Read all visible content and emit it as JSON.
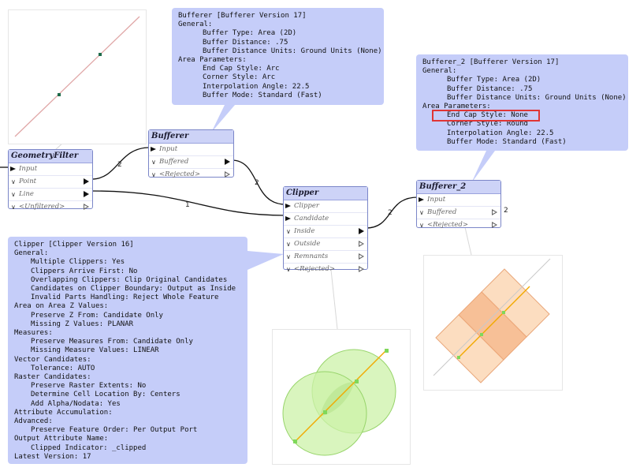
{
  "annotations": {
    "bufferer": {
      "lines": [
        {
          "text": "Bufferer [Bufferer Version 17]",
          "indent": 0
        },
        {
          "text": "General:",
          "indent": 0
        },
        {
          "text": "Buffer Type: Area (2D)",
          "indent": 2
        },
        {
          "text": "Buffer Distance: .75",
          "indent": 2
        },
        {
          "text": "Buffer Distance Units: Ground Units (None)",
          "indent": 2
        },
        {
          "text": "Area Parameters:",
          "indent": 0
        },
        {
          "text": "End Cap Style: Arc",
          "indent": 2
        },
        {
          "text": "Corner Style: Arc",
          "indent": 2
        },
        {
          "text": "Interpolation Angle: 22.5",
          "indent": 2
        },
        {
          "text": "Buffer Mode: Standard (Fast)",
          "indent": 2
        }
      ]
    },
    "bufferer_2": {
      "lines": [
        {
          "text": "Bufferer_2 [Bufferer Version 17]",
          "indent": 0
        },
        {
          "text": "General:",
          "indent": 0
        },
        {
          "text": "Buffer Type: Area (2D)",
          "indent": 2
        },
        {
          "text": "Buffer Distance: .75",
          "indent": 2
        },
        {
          "text": "Buffer Distance Units: Ground Units (None)",
          "indent": 2
        },
        {
          "text": "Area Parameters:",
          "indent": 0
        },
        {
          "text": "End Cap Style: None",
          "indent": 2,
          "highlight": true
        },
        {
          "text": "Corner Style: Round",
          "indent": 2
        },
        {
          "text": "Interpolation Angle: 22.5",
          "indent": 2
        },
        {
          "text": "Buffer Mode: Standard (Fast)",
          "indent": 2
        }
      ]
    },
    "clipper": {
      "lines": [
        {
          "text": "Clipper [Clipper Version 16]",
          "indent": 0
        },
        {
          "text": "General:",
          "indent": 0
        },
        {
          "text": "Multiple Clippers: Yes",
          "indent": 1
        },
        {
          "text": "Clippers Arrive First: No",
          "indent": 1
        },
        {
          "text": "Overlapping Clippers: Clip Original Candidates",
          "indent": 1
        },
        {
          "text": "Candidates on Clipper Boundary: Output as Inside",
          "indent": 1
        },
        {
          "text": "Invalid Parts Handling: Reject Whole Feature",
          "indent": 1
        },
        {
          "text": "Area on Area Z Values:",
          "indent": 0
        },
        {
          "text": "Preserve Z From: Candidate Only",
          "indent": 1
        },
        {
          "text": "Missing Z Values: PLANAR",
          "indent": 1
        },
        {
          "text": "Measures:",
          "indent": 0
        },
        {
          "text": "Preserve Measures From: Candidate Only",
          "indent": 1
        },
        {
          "text": "Missing Measure Values: LINEAR",
          "indent": 1
        },
        {
          "text": "Vector Candidates:",
          "indent": 0
        },
        {
          "text": "Tolerance: AUTO",
          "indent": 1
        },
        {
          "text": "Raster Candidates:",
          "indent": 0
        },
        {
          "text": "Preserve Raster Extents: No",
          "indent": 1
        },
        {
          "text": "Determine Cell Location By: Centers",
          "indent": 1
        },
        {
          "text": "Add Alpha/Nodata: Yes",
          "indent": 1
        },
        {
          "text": "Attribute Accumulation:",
          "indent": 0
        },
        {
          "text": "Advanced:",
          "indent": 0
        },
        {
          "text": "Preserve Feature Order: Per Output Port",
          "indent": 1
        },
        {
          "text": "Output Attribute Name:",
          "indent": 0
        },
        {
          "text": "Clipped Indicator: _clipped",
          "indent": 1
        },
        {
          "text": "Latest Version: 17",
          "indent": 0
        }
      ]
    }
  },
  "nodes": {
    "geometry_filter": {
      "title": "GeometryFilter",
      "in": "Input",
      "out1": "Point",
      "out2": "Line",
      "out3": "<Unfiltered>"
    },
    "bufferer": {
      "title": "Bufferer",
      "in": "Input",
      "out1": "Buffered",
      "out2": "<Rejected>"
    },
    "clipper": {
      "title": "Clipper",
      "in1": "Clipper",
      "in2": "Candidate",
      "out1": "Inside",
      "out2": "Outside",
      "out3": "Remnants",
      "out4": "<Rejected>"
    },
    "bufferer_2": {
      "title": "Bufferer_2",
      "in": "Input",
      "out1": "Buffered",
      "out2": "<Rejected>"
    }
  },
  "connections": {
    "point_to_bufferer": "2",
    "buffered_to_clipper": "2",
    "line_to_clipper": "1",
    "inside_to_bufferer_2": "2",
    "bufferer_2_buffered_count": "2"
  },
  "colors": {
    "annotation_bg": "#c5cdf9",
    "node_header": "#cdd3f7",
    "node_border": "#7b86c8",
    "highlight": "#e03535",
    "circle_fill": "#c4ef9c",
    "square_fill": "#f8c8a0",
    "line_preview": "#f2a900"
  }
}
